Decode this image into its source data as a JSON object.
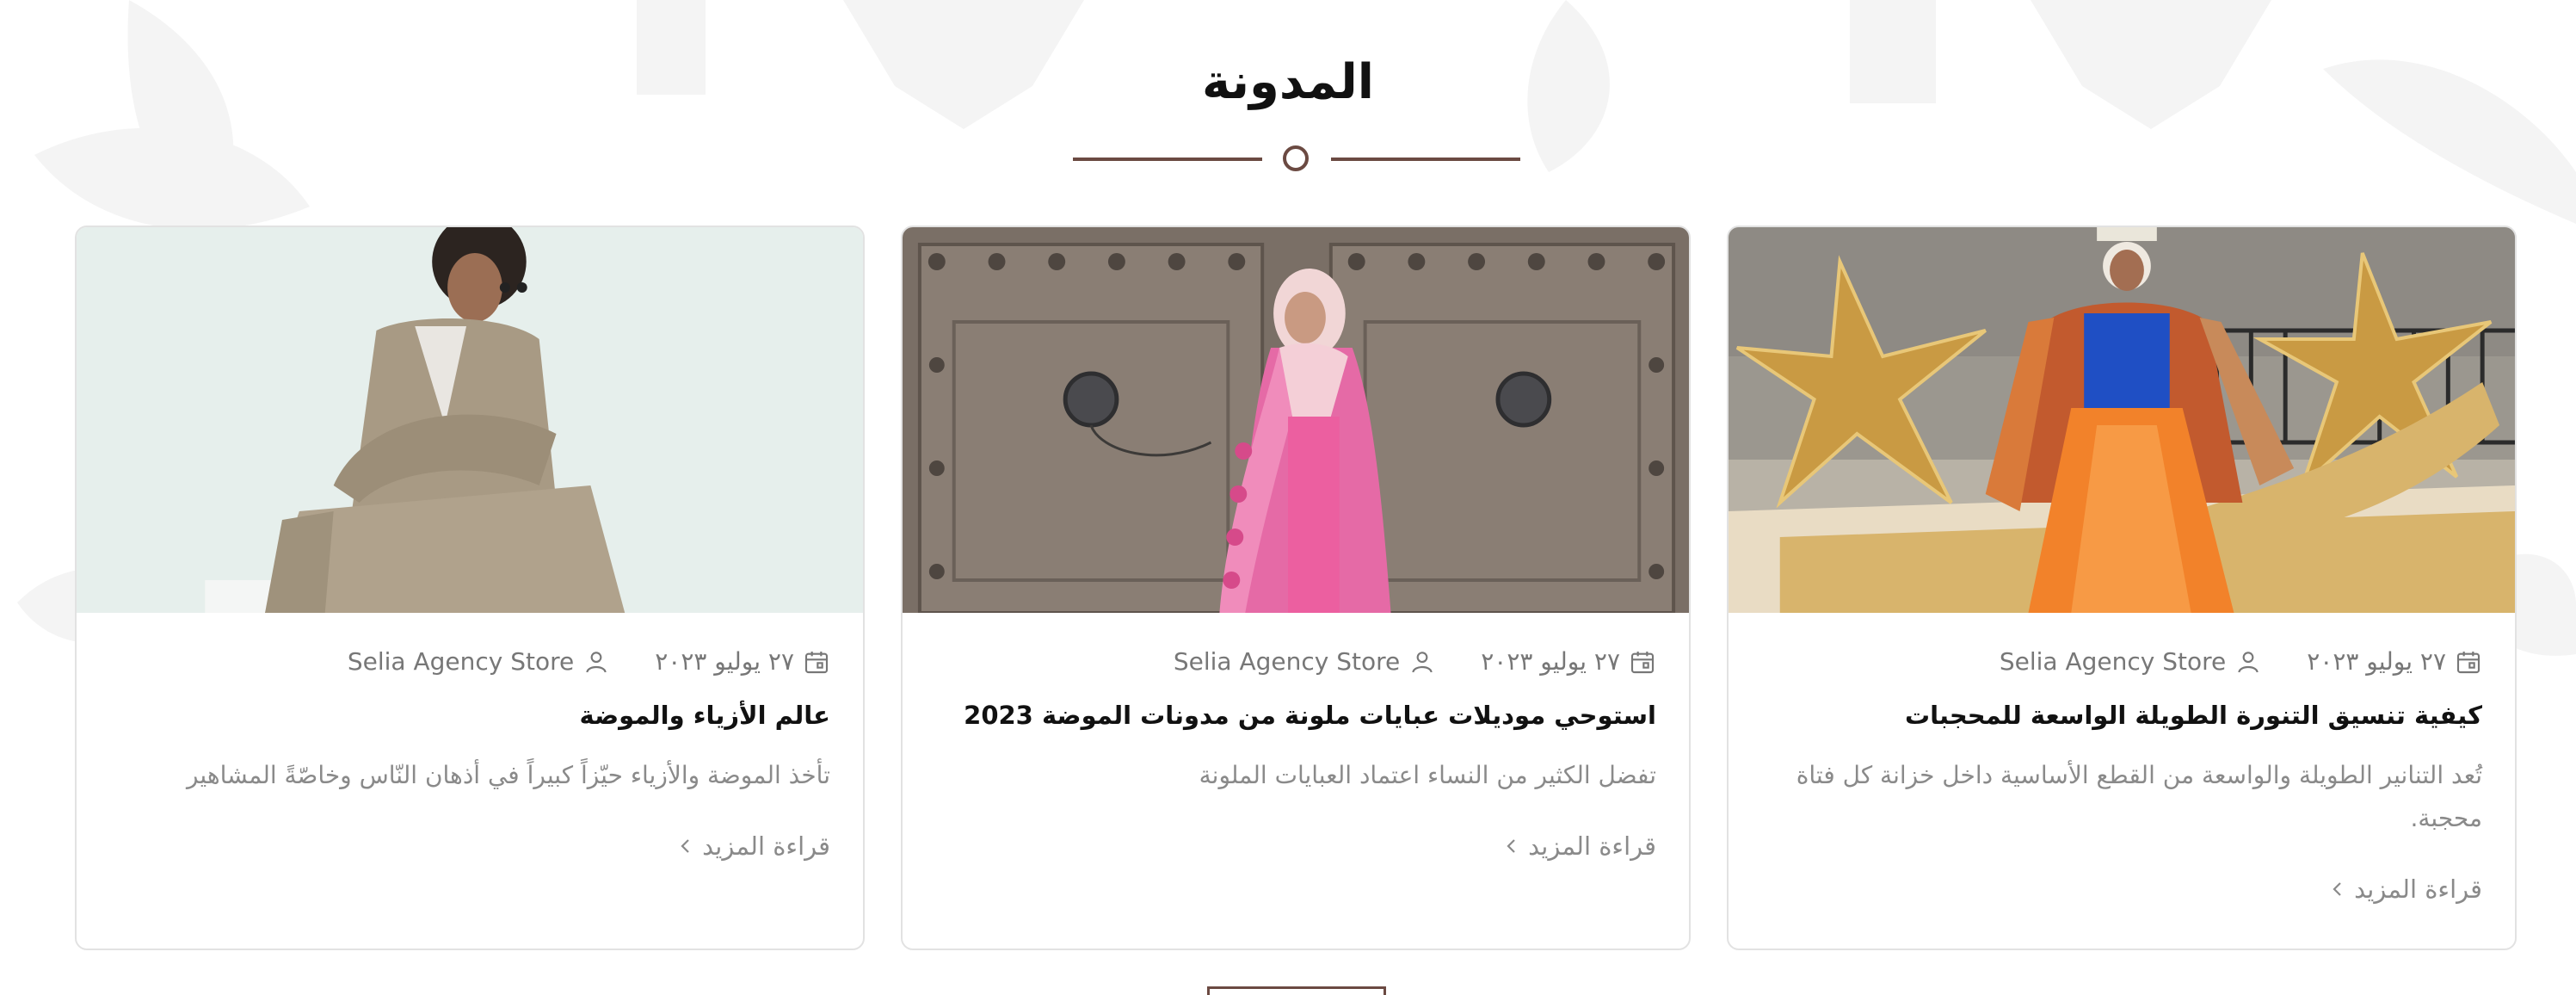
{
  "section": {
    "title": "المدونة"
  },
  "colors": {
    "accent": "#6b4a42",
    "muted_text": "#8a8a8a",
    "border": "#e2e2e2"
  },
  "cards": [
    {
      "date": "٢٧ يوليو ٢٠٢٣",
      "author": "Selia Agency Store",
      "title": "كيفية تنسيق التنورة الطويلة الواسعة للمحجبات",
      "excerpt": "تُعد التنانير الطويلة والواسعة من القطع الأساسية داخل خزانة كل فتاة محجبة.",
      "read_more": "قراءة المزيد",
      "image_icon": "hijab-orange-skirt-photo"
    },
    {
      "date": "٢٧ يوليو ٢٠٢٣",
      "author": "Selia Agency Store",
      "title": "استوحي موديلات عبايات ملونة من مدونات الموضة 2023",
      "excerpt": "تفضل الكثير من النساء اعتماد العبايات الملونة",
      "read_more": "قراءة المزيد",
      "image_icon": "pink-abaya-door-photo"
    },
    {
      "date": "٢٧ يوليو ٢٠٢٣",
      "author": "Selia Agency Store",
      "title": "عالم الأزياء والموضة",
      "excerpt": "تأخذ الموضة والأزياء حيّزاً كبيراً في أذهان النّاس وخاصّةً المشاهير",
      "read_more": "قراءة المزيد",
      "image_icon": "man-suit-photo"
    }
  ]
}
